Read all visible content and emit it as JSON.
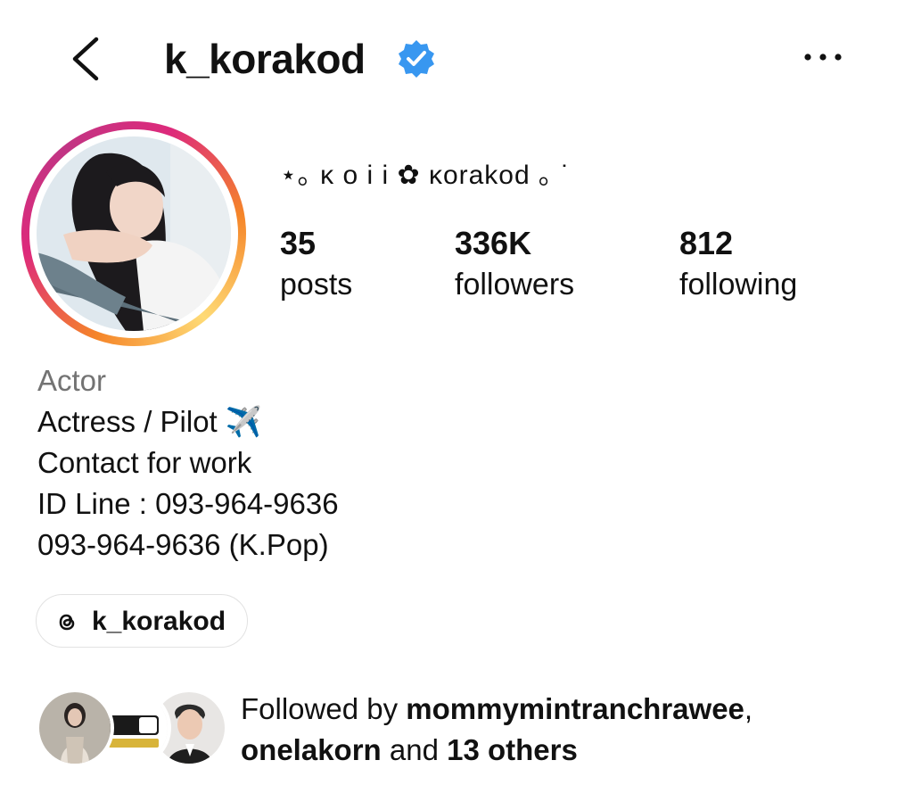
{
  "header": {
    "username": "k_korakod",
    "icons": {
      "back": "chevron-left-icon",
      "verified": "verified-badge-icon",
      "more": "more-horizontal-icon"
    },
    "accent_color": "#3897f0"
  },
  "profile": {
    "display_name": "⋆｡ ᴋ o i i ✿ ᴋorakod ｡ ˙",
    "stats": {
      "posts": {
        "count": "35",
        "label": "posts"
      },
      "followers": {
        "count": "336K",
        "label": "followers"
      },
      "following": {
        "count": "812",
        "label": "following"
      }
    }
  },
  "bio": {
    "category": "Actor",
    "lines": [
      "Actress / Pilot ✈️",
      "Contact for work",
      "ID Line : 093-964-9636",
      "093-964-9636 (K.Pop)"
    ]
  },
  "threads_link": {
    "label": "k_korakod",
    "icon": "threads-icon"
  },
  "followed_by": {
    "prefix": "Followed by",
    "user1": "mommymintranchrawee",
    "sep": ",",
    "user2": "onelakorn",
    "and": "and",
    "others": "13 others"
  }
}
